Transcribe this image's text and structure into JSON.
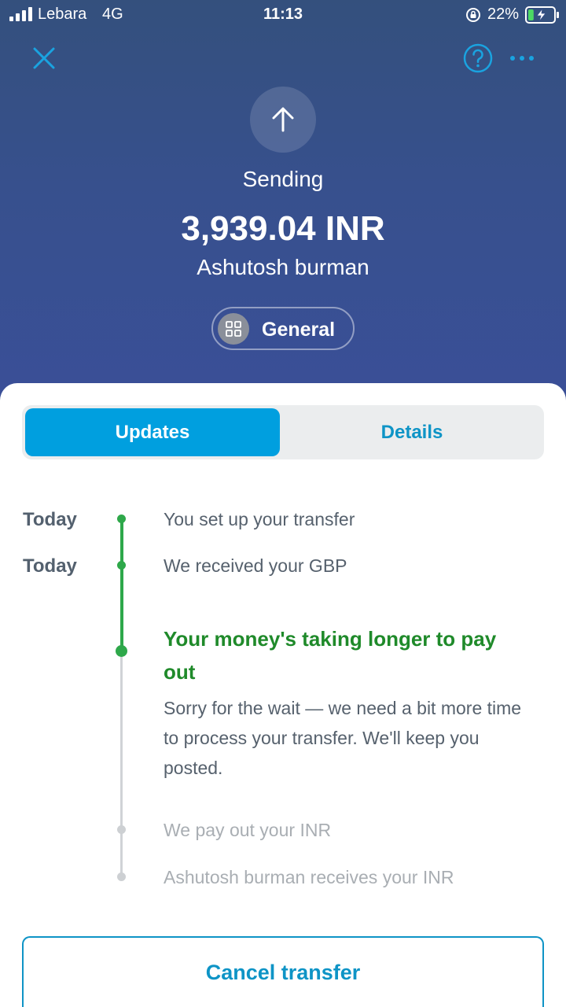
{
  "status_bar": {
    "carrier": "Lebara",
    "network": "4G",
    "time": "11:13",
    "battery_percent": "22%",
    "battery_level": 0.22,
    "signal_bars": 4
  },
  "header": {
    "close_icon": "close-icon",
    "help_icon": "help-icon",
    "more_icon": "more-icon",
    "direction_icon": "arrow-up-icon",
    "status_label": "Sending",
    "amount": "3,939.04 INR",
    "recipient": "Ashutosh burman",
    "category": {
      "icon": "grid-icon",
      "label": "General"
    }
  },
  "tabs": [
    {
      "label": "Updates",
      "active": true
    },
    {
      "label": "Details",
      "active": false
    }
  ],
  "timeline": {
    "steps": [
      {
        "date": "Today",
        "text": "You set up your transfer",
        "state": "done"
      },
      {
        "date": "Today",
        "text": "We received your GBP",
        "state": "done"
      },
      {
        "date": "",
        "title": "Your money's taking longer to pay out",
        "body": "Sorry for the wait — we need a bit more time to process your transfer. We'll keep you posted.",
        "state": "current"
      },
      {
        "date": "",
        "text": "We pay out your INR",
        "state": "pending"
      },
      {
        "date": "",
        "text": "Ashutosh burman receives your INR",
        "state": "pending"
      }
    ]
  },
  "actions": {
    "cancel_label": "Cancel transfer"
  },
  "colors": {
    "header_bg": "#37508d",
    "accent_blue": "#009fdf",
    "link_blue": "#0e94c6",
    "success_green": "#2ea84a",
    "alert_green": "#1f8a2a"
  }
}
